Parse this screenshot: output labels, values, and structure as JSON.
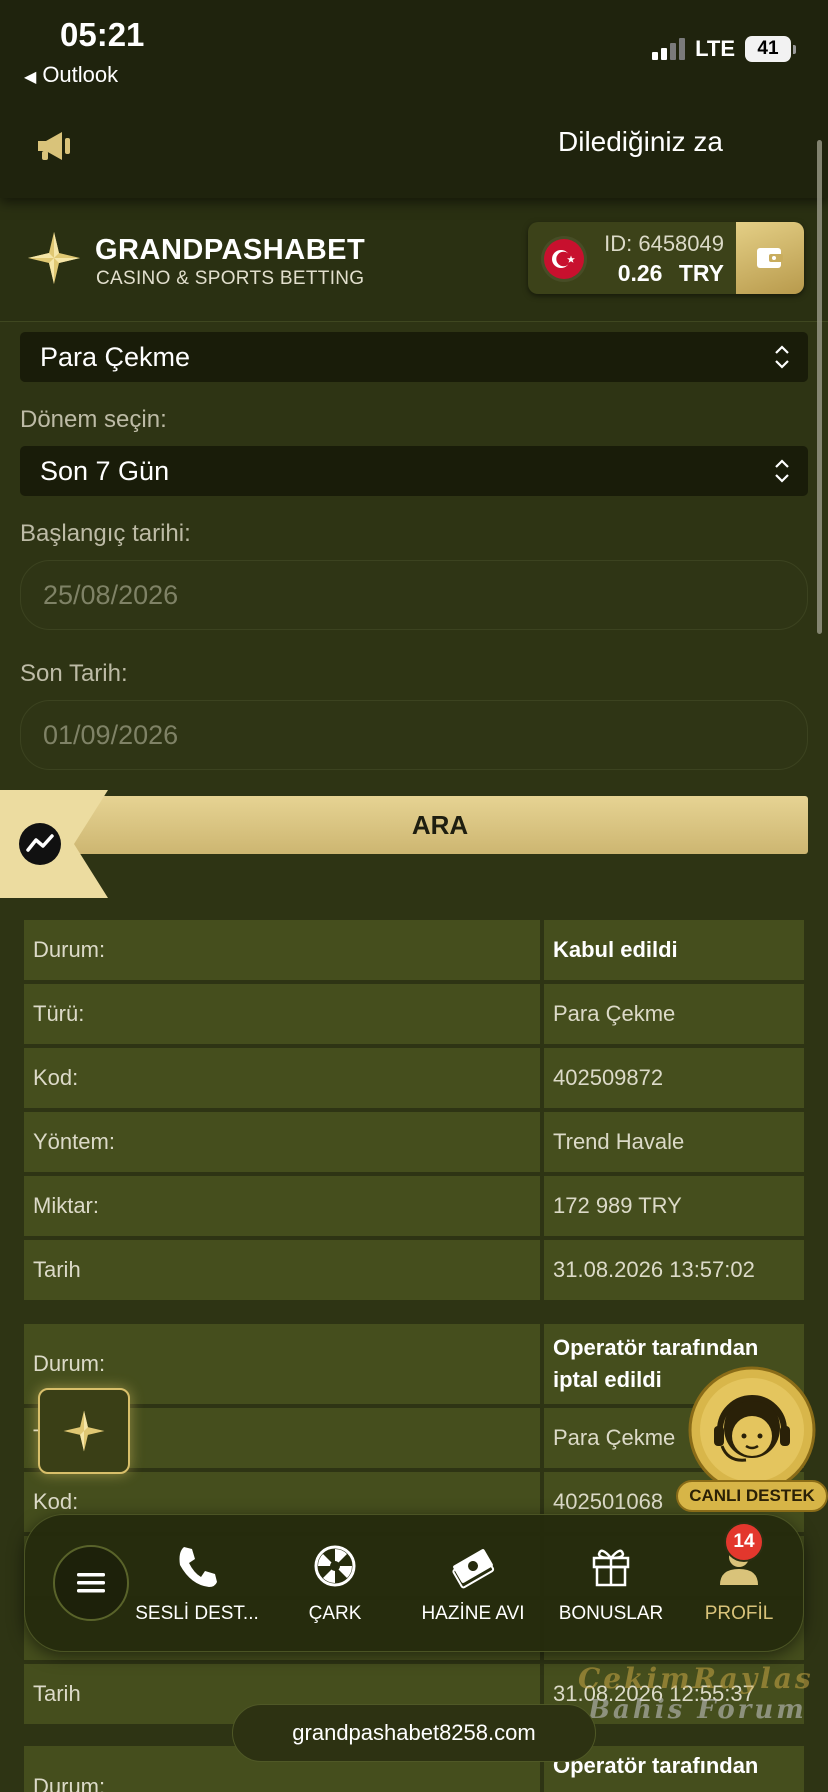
{
  "status_bar": {
    "time": "05:21",
    "back_app": "Outlook",
    "network": "LTE",
    "battery": "41"
  },
  "announcement": {
    "text": "Dilediğiniz za"
  },
  "brand": {
    "name": "GRANDPASHABET",
    "tagline": "CASINO & SPORTS BETTING"
  },
  "account": {
    "id_text": "ID: 6458049",
    "balance": "0.26",
    "currency": "TRY"
  },
  "filters": {
    "type_selected": "Para Çekme",
    "period_label": "Dönem seçin:",
    "period_selected": "Son 7 Gün",
    "start_label": "Başlangıç tarihi:",
    "start_value": "25/08/2026",
    "end_label": "Son Tarih:",
    "end_value": "01/09/2026",
    "search_button": "ARA"
  },
  "transactions": [
    {
      "rows": [
        {
          "label": "Durum:",
          "value": "Kabul edildi"
        },
        {
          "label": "Türü:",
          "value": "Para Çekme"
        },
        {
          "label": "Kod:",
          "value": "402509872"
        },
        {
          "label": "Yöntem:",
          "value": "Trend Havale"
        },
        {
          "label": "Miktar:",
          "value": "172 989 TRY"
        },
        {
          "label": "Tarih",
          "value": "31.08.2026 13:57:02"
        }
      ]
    },
    {
      "rows": [
        {
          "label": "Durum:",
          "value_line1": "Operatör tarafından",
          "value_line2": "iptal edildi"
        },
        {
          "label": "T",
          "value": "Para Çekme"
        },
        {
          "label": "Kod:",
          "value": "402501068"
        },
        {
          "label": "Tarih",
          "value": "31.08.2026 12:55:37"
        }
      ]
    },
    {
      "rows": [
        {
          "label": "Durum:",
          "value_line1": "Operatör tarafından"
        }
      ]
    }
  ],
  "live_support": {
    "label": "CANLI DESTEK"
  },
  "bottom_nav": {
    "items": [
      {
        "label": "SESLİ DEST...",
        "icon": "phone-icon"
      },
      {
        "label": "ÇARK",
        "icon": "wheel-icon"
      },
      {
        "label": "HAZİNE AVI",
        "icon": "treasure-icon"
      },
      {
        "label": "BONUSLAR",
        "icon": "gift-icon"
      },
      {
        "label": "PROFİL",
        "icon": "user-icon"
      }
    ],
    "profile_badge": "14"
  },
  "domain": "grandpashabet8258.com",
  "watermark": {
    "line1": "CekimRaylas",
    "line2": "Bahis Forum"
  },
  "colors": {
    "background": "#2e3414",
    "gold": "#d9c37a",
    "cell": "#454e1d",
    "badge": "#e3372d"
  }
}
